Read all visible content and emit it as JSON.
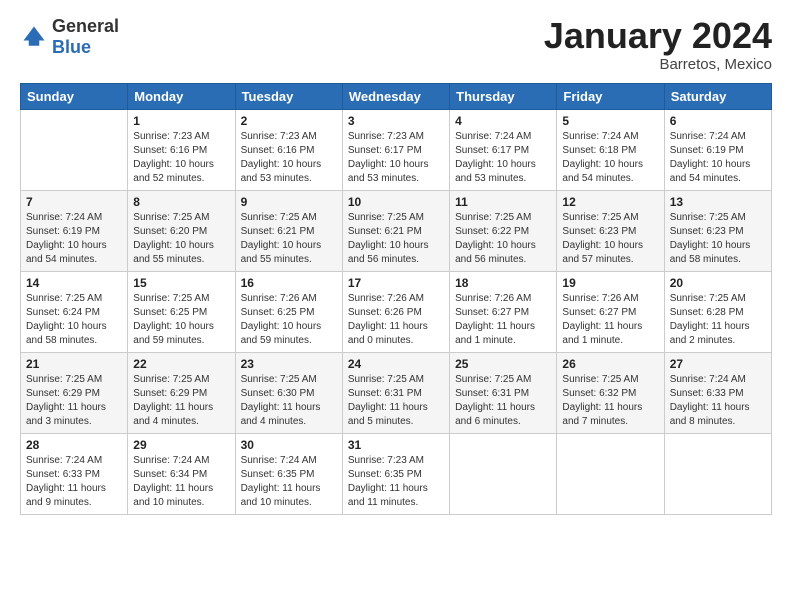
{
  "logo": {
    "general": "General",
    "blue": "Blue"
  },
  "title": {
    "month_year": "January 2024",
    "location": "Barretos, Mexico"
  },
  "days_of_week": [
    "Sunday",
    "Monday",
    "Tuesday",
    "Wednesday",
    "Thursday",
    "Friday",
    "Saturday"
  ],
  "weeks": [
    [
      {
        "day": "",
        "sunrise": "",
        "sunset": "",
        "daylight": ""
      },
      {
        "day": "1",
        "sunrise": "Sunrise: 7:23 AM",
        "sunset": "Sunset: 6:16 PM",
        "daylight": "Daylight: 10 hours and 52 minutes."
      },
      {
        "day": "2",
        "sunrise": "Sunrise: 7:23 AM",
        "sunset": "Sunset: 6:16 PM",
        "daylight": "Daylight: 10 hours and 53 minutes."
      },
      {
        "day": "3",
        "sunrise": "Sunrise: 7:23 AM",
        "sunset": "Sunset: 6:17 PM",
        "daylight": "Daylight: 10 hours and 53 minutes."
      },
      {
        "day": "4",
        "sunrise": "Sunrise: 7:24 AM",
        "sunset": "Sunset: 6:17 PM",
        "daylight": "Daylight: 10 hours and 53 minutes."
      },
      {
        "day": "5",
        "sunrise": "Sunrise: 7:24 AM",
        "sunset": "Sunset: 6:18 PM",
        "daylight": "Daylight: 10 hours and 54 minutes."
      },
      {
        "day": "6",
        "sunrise": "Sunrise: 7:24 AM",
        "sunset": "Sunset: 6:19 PM",
        "daylight": "Daylight: 10 hours and 54 minutes."
      }
    ],
    [
      {
        "day": "7",
        "sunrise": "Sunrise: 7:24 AM",
        "sunset": "Sunset: 6:19 PM",
        "daylight": "Daylight: 10 hours and 54 minutes."
      },
      {
        "day": "8",
        "sunrise": "Sunrise: 7:25 AM",
        "sunset": "Sunset: 6:20 PM",
        "daylight": "Daylight: 10 hours and 55 minutes."
      },
      {
        "day": "9",
        "sunrise": "Sunrise: 7:25 AM",
        "sunset": "Sunset: 6:21 PM",
        "daylight": "Daylight: 10 hours and 55 minutes."
      },
      {
        "day": "10",
        "sunrise": "Sunrise: 7:25 AM",
        "sunset": "Sunset: 6:21 PM",
        "daylight": "Daylight: 10 hours and 56 minutes."
      },
      {
        "day": "11",
        "sunrise": "Sunrise: 7:25 AM",
        "sunset": "Sunset: 6:22 PM",
        "daylight": "Daylight: 10 hours and 56 minutes."
      },
      {
        "day": "12",
        "sunrise": "Sunrise: 7:25 AM",
        "sunset": "Sunset: 6:23 PM",
        "daylight": "Daylight: 10 hours and 57 minutes."
      },
      {
        "day": "13",
        "sunrise": "Sunrise: 7:25 AM",
        "sunset": "Sunset: 6:23 PM",
        "daylight": "Daylight: 10 hours and 58 minutes."
      }
    ],
    [
      {
        "day": "14",
        "sunrise": "Sunrise: 7:25 AM",
        "sunset": "Sunset: 6:24 PM",
        "daylight": "Daylight: 10 hours and 58 minutes."
      },
      {
        "day": "15",
        "sunrise": "Sunrise: 7:25 AM",
        "sunset": "Sunset: 6:25 PM",
        "daylight": "Daylight: 10 hours and 59 minutes."
      },
      {
        "day": "16",
        "sunrise": "Sunrise: 7:26 AM",
        "sunset": "Sunset: 6:25 PM",
        "daylight": "Daylight: 10 hours and 59 minutes."
      },
      {
        "day": "17",
        "sunrise": "Sunrise: 7:26 AM",
        "sunset": "Sunset: 6:26 PM",
        "daylight": "Daylight: 11 hours and 0 minutes."
      },
      {
        "day": "18",
        "sunrise": "Sunrise: 7:26 AM",
        "sunset": "Sunset: 6:27 PM",
        "daylight": "Daylight: 11 hours and 1 minute."
      },
      {
        "day": "19",
        "sunrise": "Sunrise: 7:26 AM",
        "sunset": "Sunset: 6:27 PM",
        "daylight": "Daylight: 11 hours and 1 minute."
      },
      {
        "day": "20",
        "sunrise": "Sunrise: 7:25 AM",
        "sunset": "Sunset: 6:28 PM",
        "daylight": "Daylight: 11 hours and 2 minutes."
      }
    ],
    [
      {
        "day": "21",
        "sunrise": "Sunrise: 7:25 AM",
        "sunset": "Sunset: 6:29 PM",
        "daylight": "Daylight: 11 hours and 3 minutes."
      },
      {
        "day": "22",
        "sunrise": "Sunrise: 7:25 AM",
        "sunset": "Sunset: 6:29 PM",
        "daylight": "Daylight: 11 hours and 4 minutes."
      },
      {
        "day": "23",
        "sunrise": "Sunrise: 7:25 AM",
        "sunset": "Sunset: 6:30 PM",
        "daylight": "Daylight: 11 hours and 4 minutes."
      },
      {
        "day": "24",
        "sunrise": "Sunrise: 7:25 AM",
        "sunset": "Sunset: 6:31 PM",
        "daylight": "Daylight: 11 hours and 5 minutes."
      },
      {
        "day": "25",
        "sunrise": "Sunrise: 7:25 AM",
        "sunset": "Sunset: 6:31 PM",
        "daylight": "Daylight: 11 hours and 6 minutes."
      },
      {
        "day": "26",
        "sunrise": "Sunrise: 7:25 AM",
        "sunset": "Sunset: 6:32 PM",
        "daylight": "Daylight: 11 hours and 7 minutes."
      },
      {
        "day": "27",
        "sunrise": "Sunrise: 7:24 AM",
        "sunset": "Sunset: 6:33 PM",
        "daylight": "Daylight: 11 hours and 8 minutes."
      }
    ],
    [
      {
        "day": "28",
        "sunrise": "Sunrise: 7:24 AM",
        "sunset": "Sunset: 6:33 PM",
        "daylight": "Daylight: 11 hours and 9 minutes."
      },
      {
        "day": "29",
        "sunrise": "Sunrise: 7:24 AM",
        "sunset": "Sunset: 6:34 PM",
        "daylight": "Daylight: 11 hours and 10 minutes."
      },
      {
        "day": "30",
        "sunrise": "Sunrise: 7:24 AM",
        "sunset": "Sunset: 6:35 PM",
        "daylight": "Daylight: 11 hours and 10 minutes."
      },
      {
        "day": "31",
        "sunrise": "Sunrise: 7:23 AM",
        "sunset": "Sunset: 6:35 PM",
        "daylight": "Daylight: 11 hours and 11 minutes."
      },
      {
        "day": "",
        "sunrise": "",
        "sunset": "",
        "daylight": ""
      },
      {
        "day": "",
        "sunrise": "",
        "sunset": "",
        "daylight": ""
      },
      {
        "day": "",
        "sunrise": "",
        "sunset": "",
        "daylight": ""
      }
    ]
  ]
}
